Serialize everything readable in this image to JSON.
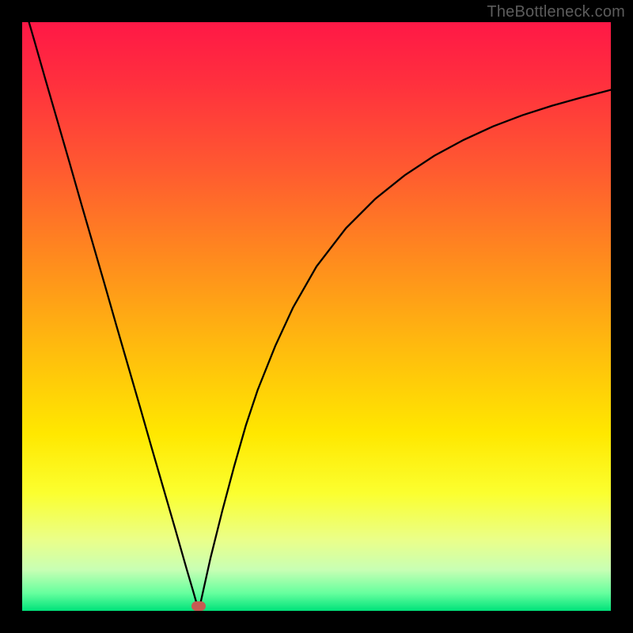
{
  "watermark": "TheBottleneck.com",
  "chart_data": {
    "type": "line",
    "title": "",
    "xlabel": "",
    "ylabel": "",
    "xlim": [
      0,
      100
    ],
    "ylim": [
      0,
      100
    ],
    "grid": false,
    "legend": false,
    "gradient_stops": [
      {
        "offset": 0.0,
        "color": "#ff1846"
      },
      {
        "offset": 0.1,
        "color": "#ff2f3e"
      },
      {
        "offset": 0.25,
        "color": "#ff5a30"
      },
      {
        "offset": 0.4,
        "color": "#ff8a1e"
      },
      {
        "offset": 0.55,
        "color": "#ffba0e"
      },
      {
        "offset": 0.7,
        "color": "#ffe800"
      },
      {
        "offset": 0.8,
        "color": "#fbff2f"
      },
      {
        "offset": 0.88,
        "color": "#eaff8a"
      },
      {
        "offset": 0.93,
        "color": "#c8ffb4"
      },
      {
        "offset": 0.97,
        "color": "#66ff9e"
      },
      {
        "offset": 1.0,
        "color": "#00e27a"
      }
    ],
    "series": [
      {
        "name": "left-branch",
        "x": [
          0.0,
          2.0,
          4.0,
          6.0,
          8.0,
          10.0,
          12.0,
          14.0,
          16.0,
          18.0,
          20.0,
          22.0,
          24.0,
          26.0,
          28.0,
          29.0,
          30.0
        ],
        "values": [
          104.0,
          97.1,
          90.1,
          83.2,
          76.3,
          69.3,
          62.4,
          55.5,
          48.5,
          41.6,
          34.7,
          27.7,
          20.8,
          13.9,
          6.9,
          3.5,
          0.0
        ]
      },
      {
        "name": "right-branch",
        "x": [
          30.0,
          32.0,
          34.0,
          36.0,
          38.0,
          40.0,
          43.0,
          46.0,
          50.0,
          55.0,
          60.0,
          65.0,
          70.0,
          75.0,
          80.0,
          85.0,
          90.0,
          95.0,
          100.0
        ],
        "values": [
          0.0,
          9.0,
          17.0,
          24.5,
          31.5,
          37.5,
          45.0,
          51.5,
          58.5,
          65.0,
          70.0,
          74.0,
          77.3,
          80.0,
          82.3,
          84.2,
          85.8,
          87.2,
          88.5
        ]
      }
    ],
    "marker": {
      "x": 30.0,
      "y": 0.8
    },
    "curve_color": "#000000",
    "curve_width": 2.3
  }
}
